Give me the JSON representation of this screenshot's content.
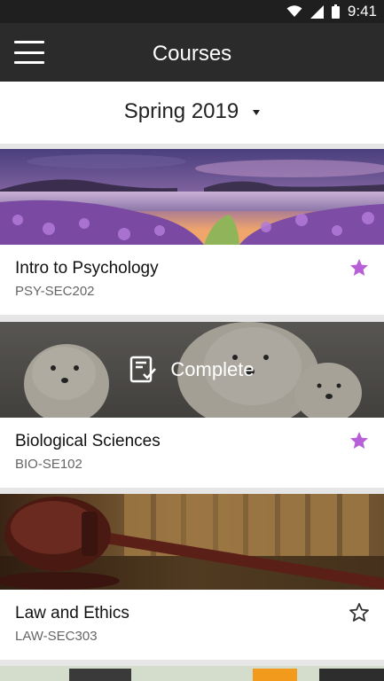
{
  "status_bar": {
    "time": "9:41",
    "icons": [
      "wifi-icon",
      "signal-icon",
      "battery-icon"
    ]
  },
  "app_bar": {
    "title": "Courses",
    "menu_icon": "hamburger-menu-icon"
  },
  "term_selector": {
    "value": "Spring 2019"
  },
  "courses": [
    {
      "title": "Intro to Psychology",
      "code": "PSY-SEC202",
      "favorite": true,
      "status": "",
      "image": "lakeside sunset with purple flowers"
    },
    {
      "title": "Biological Sciences",
      "code": "BIO-SE102",
      "favorite": true,
      "status": "Complete",
      "image": "polar bears"
    },
    {
      "title": "Law and Ethics",
      "code": "LAW-SEC303",
      "favorite": false,
      "status": "",
      "image": "judge gavel with law books"
    }
  ],
  "colors": {
    "app_bar": "#2b2b2b",
    "status_bar": "#1f1f1f",
    "favorite_star": "#b65fd6",
    "background": "#e6e6e6"
  }
}
